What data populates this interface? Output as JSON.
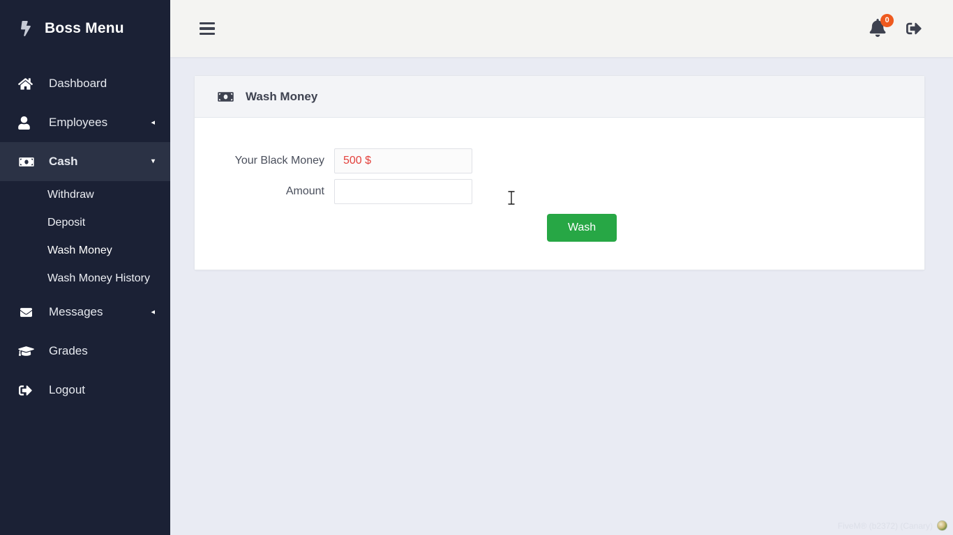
{
  "sidebar": {
    "brand": {
      "label": "Boss Menu",
      "icon": "bolt-icon"
    },
    "items": [
      {
        "label": "Dashboard",
        "icon": "home-icon",
        "caret": "",
        "active": false
      },
      {
        "label": "Employees",
        "icon": "user-icon",
        "caret": "◂",
        "active": false
      },
      {
        "label": "Cash",
        "icon": "money-icon",
        "caret": "▾",
        "active": true
      },
      {
        "label": "Messages",
        "icon": "envelope-icon",
        "caret": "◂",
        "active": false
      },
      {
        "label": "Grades",
        "icon": "graduation-cap-icon",
        "caret": "",
        "active": false
      },
      {
        "label": "Logout",
        "icon": "sign-out-icon",
        "caret": "",
        "active": false
      }
    ],
    "submenu": [
      {
        "label": "Withdraw"
      },
      {
        "label": "Deposit"
      },
      {
        "label": "Wash Money"
      },
      {
        "label": "Wash Money History"
      }
    ]
  },
  "topbar": {
    "menu_toggle": "hamburger-icon",
    "notification_count": "0",
    "notification_badge_color": "#ee5a1f",
    "logout_icon": "sign-out-icon"
  },
  "card": {
    "icon": "money-icon",
    "title": "Wash Money",
    "fields": [
      {
        "label": "Your Black Money",
        "value": "500 $",
        "placeholder": "",
        "readonly": true
      },
      {
        "label": "Amount",
        "value": "",
        "placeholder": "",
        "readonly": false
      }
    ],
    "submit_label": "Wash",
    "submit_color": "#27a745",
    "money_value_color": "#e3413c"
  },
  "watermark": {
    "text": "FiveM® (b2372) (Canary)"
  }
}
